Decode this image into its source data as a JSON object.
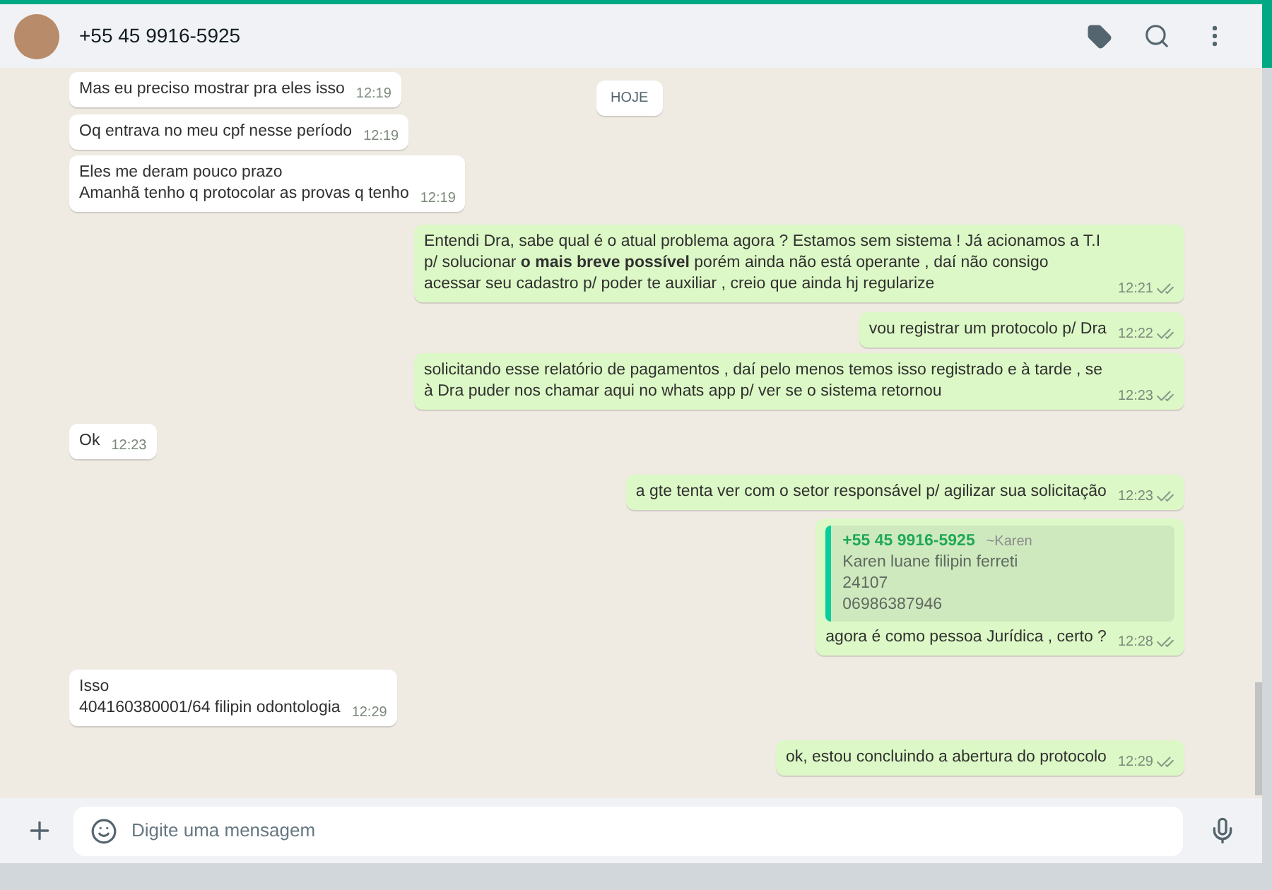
{
  "header": {
    "title": "+55 45 9916-5925"
  },
  "date_chip": "HOJE",
  "messages": [
    {
      "kind": "in",
      "lines": [
        "Mas eu preciso mostrar pra eles isso"
      ],
      "time": "12:19"
    },
    {
      "kind": "in",
      "lines": [
        "Oq entrava no meu cpf nesse período"
      ],
      "time": "12:19"
    },
    {
      "kind": "in",
      "lines": [
        "Eles me deram pouco prazo",
        "Amanhã tenho q protocolar as provas q tenho"
      ],
      "time": "12:19"
    },
    {
      "kind": "out",
      "lines": [
        "Entendi Dra, sabe qual é o atual problema agora ? Estamos sem sistema ! Já acionamos a T.I p/ solucionar **o mais breve possível** porém ainda não está operante , daí não consigo acessar seu cadastro p/ poder te auxiliar , creio que ainda hj regularize"
      ],
      "time": "12:21",
      "read": false
    },
    {
      "kind": "out",
      "lines": [
        "vou registrar um protocolo p/ Dra"
      ],
      "time": "12:22",
      "read": false
    },
    {
      "kind": "out",
      "lines": [
        "solicitando esse relatório de pagamentos , daí pelo menos temos isso registrado e à tarde , se à Dra puder nos chamar aqui no whats app p/ ver se o sistema retornou"
      ],
      "time": "12:23",
      "read": false
    },
    {
      "kind": "in",
      "lines": [
        "Ok"
      ],
      "time": "12:23"
    },
    {
      "kind": "out",
      "lines": [
        "a gte tenta ver com o setor responsável p/ agilizar sua solicitação"
      ],
      "time": "12:23",
      "read": false
    },
    {
      "kind": "out",
      "quote": {
        "sender": "+55 45 9916-5925",
        "alias": "~Karen",
        "lines": [
          "Karen luane filipin ferreti",
          "24107",
          "06986387946"
        ]
      },
      "lines": [
        "agora é como pessoa Jurídica , certo ?"
      ],
      "time": "12:28",
      "read": false
    },
    {
      "kind": "in",
      "lines": [
        "Isso",
        "404160380001/64 filipin odontologia"
      ],
      "time": "12:29"
    },
    {
      "kind": "out",
      "lines": [
        "ok, estou concluindo a abertura do protocolo"
      ],
      "time": "12:29",
      "read": false
    }
  ],
  "composer": {
    "placeholder": "Digite uma mensagem"
  }
}
